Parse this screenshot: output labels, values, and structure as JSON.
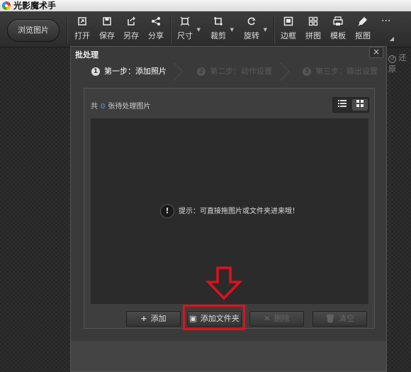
{
  "app": {
    "title": "光影魔术手"
  },
  "toolbar": {
    "browse_label": "浏览图片",
    "tools": [
      {
        "label": "打开",
        "icon": "open-icon"
      },
      {
        "label": "保存",
        "icon": "save-icon"
      },
      {
        "label": "另存",
        "icon": "save-as-icon"
      },
      {
        "label": "分享",
        "icon": "share-icon"
      },
      {
        "label": "尺寸",
        "icon": "resize-icon"
      },
      {
        "label": "裁剪",
        "icon": "crop-icon"
      },
      {
        "label": "旋转",
        "icon": "rotate-icon"
      },
      {
        "label": "边框",
        "icon": "border-icon"
      },
      {
        "label": "拼图",
        "icon": "collage-icon"
      },
      {
        "label": "模板",
        "icon": "template-icon"
      },
      {
        "label": "抠图",
        "icon": "cutout-icon"
      }
    ],
    "more": "···"
  },
  "background": {
    "restore_label": "还原"
  },
  "dialog": {
    "title": "批处理",
    "close": "×",
    "steps": [
      {
        "num": "1",
        "label": "第一步：添加照片",
        "active": true
      },
      {
        "num": "2",
        "label": "第二步：动作设置",
        "active": false
      },
      {
        "num": "3",
        "label": "第三步：输出设置",
        "active": false
      }
    ],
    "count_prefix": "共",
    "count_value": "0",
    "count_suffix": "张待处理图片",
    "hint": "提示：可直接拖图片或文件夹进来哦！",
    "buttons": {
      "add": "添加",
      "add_folder": "添加文件夹",
      "delete": "删除",
      "clear": "清空"
    }
  },
  "colors": {
    "accent_count": "#4aa3ff",
    "annotation_red": "#e0111b"
  }
}
